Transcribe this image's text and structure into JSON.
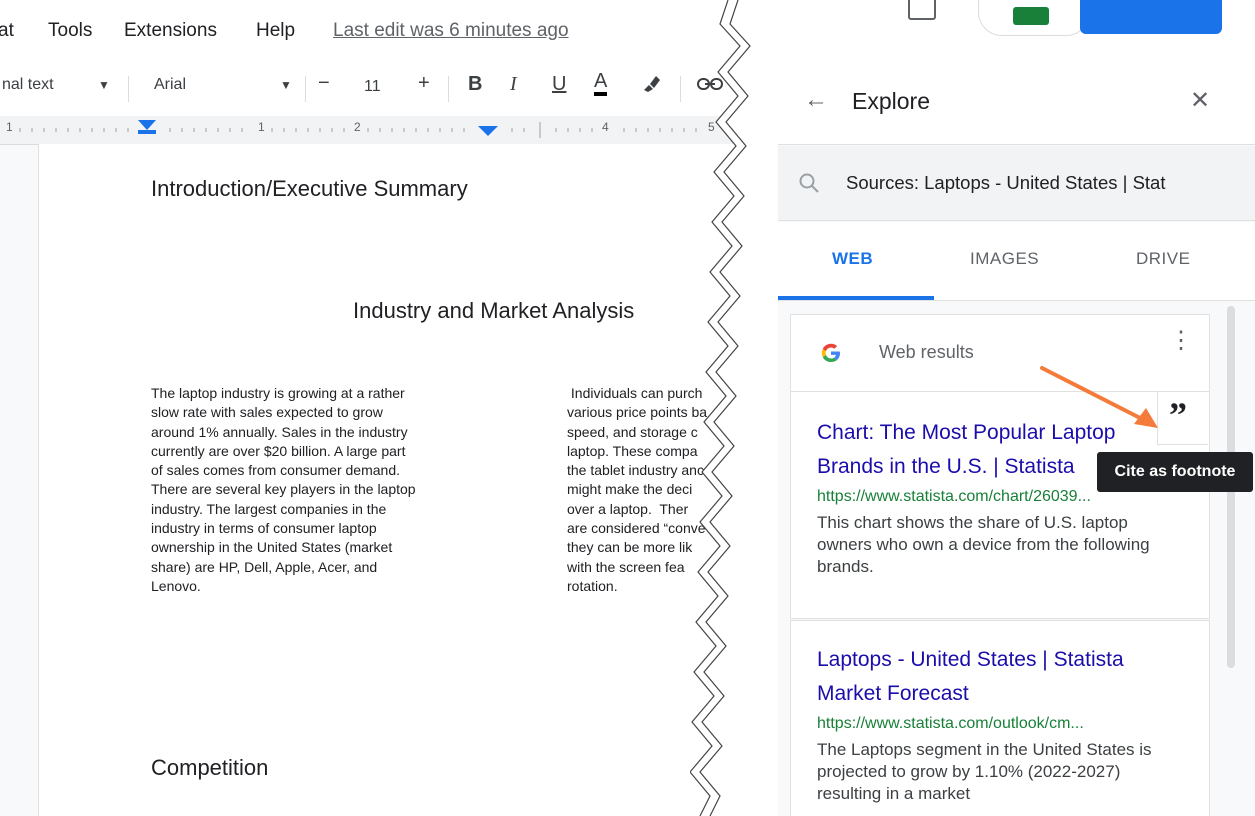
{
  "menu": {
    "items": [
      "at",
      "Tools",
      "Extensions",
      "Help"
    ],
    "last_edit": "Last edit was 6 minutes ago"
  },
  "toolbar": {
    "style": "nal text",
    "font": "Arial",
    "font_size": "11",
    "minus": "−",
    "plus": "+",
    "bold": "B",
    "italic": "I",
    "underline": "U",
    "text_color": "A"
  },
  "ruler": {
    "marks": [
      "1",
      "1",
      "2",
      "4",
      "5"
    ]
  },
  "document": {
    "heading1": "Introduction/Executive Summary",
    "heading2": "Industry and Market Analysis",
    "col1": "The laptop industry is growing at a rather\nslow rate with sales expected to grow\naround 1% annually.  Sales in the industry\ncurrently are over $20 billion.  A large part\nof sales comes from consumer demand.\nThere are several key players in the laptop\nindustry.  The largest companies in the\nindustry in terms of consumer laptop\nownership in the United States (market\nshare) are HP, Dell, Apple, Acer, and\nLenovo.",
    "col2": " Individuals can purch\nvarious price points ba\nspeed, and storage c\nlaptop. These compa\nthe tablet industry anc\nmight make the deci\nover a laptop.  Ther\nare considered “conve\nthey can be more lik\nwith the screen fea\nrotation.",
    "heading3": "Competition"
  },
  "explore": {
    "title": "Explore",
    "search_text": "Sources: Laptops - United States | Stat",
    "tabs": [
      "WEB",
      "IMAGES",
      "DRIVE"
    ],
    "web_results_label": "Web results",
    "results": [
      {
        "title": "Chart: The Most Popular Laptop Brands in the U.S. | Statista",
        "url": "https://www.statista.com/chart/26039...",
        "snippet": "This chart shows the share of U.S. laptop owners who own a device from the following brands."
      },
      {
        "title": "Laptops - United States | Statista Market Forecast",
        "url": "https://www.statista.com/outlook/cm...",
        "snippet": "The Laptops segment in the United States is projected to grow by 1.10% (2022-2027) resulting in a market"
      }
    ],
    "tooltip": "Cite as footnote"
  },
  "colors": {
    "accent_blue": "#1a73e8",
    "link": "#1a0dab",
    "url_green": "#188038",
    "arrow_orange": "#f47b3a"
  }
}
